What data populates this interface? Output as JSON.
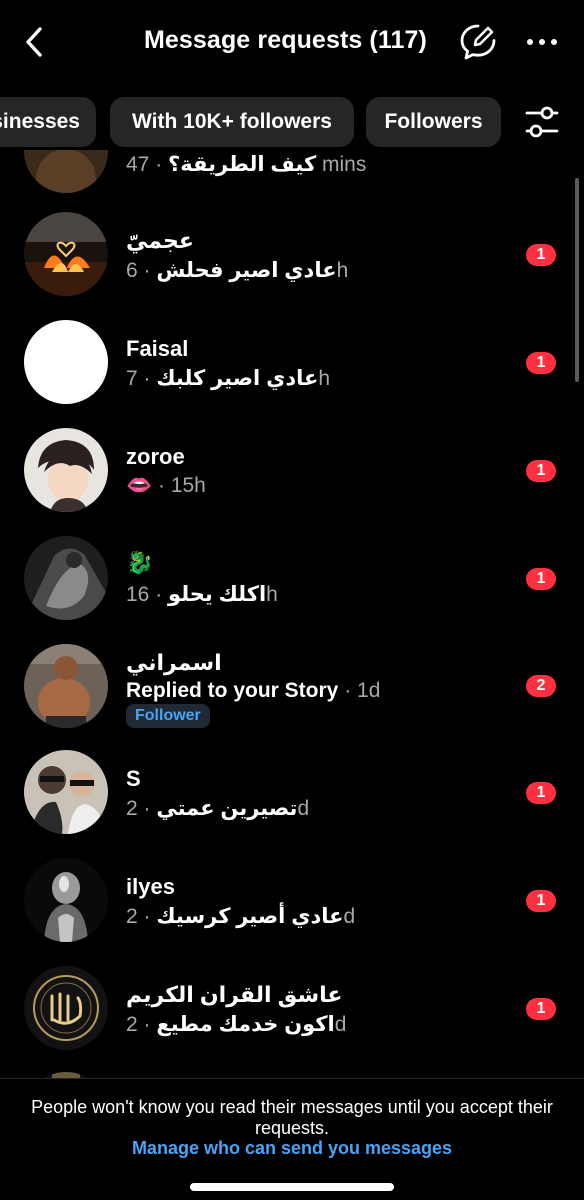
{
  "header": {
    "title": "Message requests (117)",
    "back_icon": "chevron-left-icon",
    "compose_icon": "message-edit-icon",
    "more_icon": "more-dots-icon"
  },
  "filters": {
    "chips": [
      "sinesses",
      "With 10K+ followers",
      "Followers"
    ],
    "settings_icon": "sliders-icon"
  },
  "requests": [
    {
      "name": "",
      "message": "كيف الطريقة؟",
      "time": "· 47 mins",
      "unread": ""
    },
    {
      "name": "عجميّ",
      "message": "عادي اصير فحلش",
      "time": "· 6h",
      "unread": "1"
    },
    {
      "name": "Faisal",
      "message": "عادي اصير كلبك",
      "time": "· 7h",
      "unread": "1"
    },
    {
      "name": "zoroe",
      "message": "👄",
      "time": "· 15h",
      "unread": "1"
    },
    {
      "name": "🐉",
      "message": "اكلك يحلو",
      "time": "· 16h",
      "unread": "1"
    },
    {
      "name": "اسمراني",
      "message": "Replied to your Story",
      "time": "· 1d",
      "unread": "2",
      "tag": "Follower"
    },
    {
      "name": "S",
      "message": "تصيرين عمتي",
      "time": "· 2d",
      "unread": "1"
    },
    {
      "name": "ilyes",
      "message": "عادي أصير كرسيك",
      "time": "· 2d",
      "unread": "1"
    },
    {
      "name": "عاشق القران الكريم",
      "message": "اكون خدمك مطيع",
      "time": "· 2d",
      "unread": "1"
    }
  ],
  "footer": {
    "notice": "People won't know you read their messages until you accept their requests.",
    "link": "Manage who can send you messages"
  },
  "colors": {
    "background": "#000000",
    "chip": "#262626",
    "unread_badge": "#ff3040",
    "link": "#4aa3f5",
    "secondary_text": "#a8a8a8"
  }
}
